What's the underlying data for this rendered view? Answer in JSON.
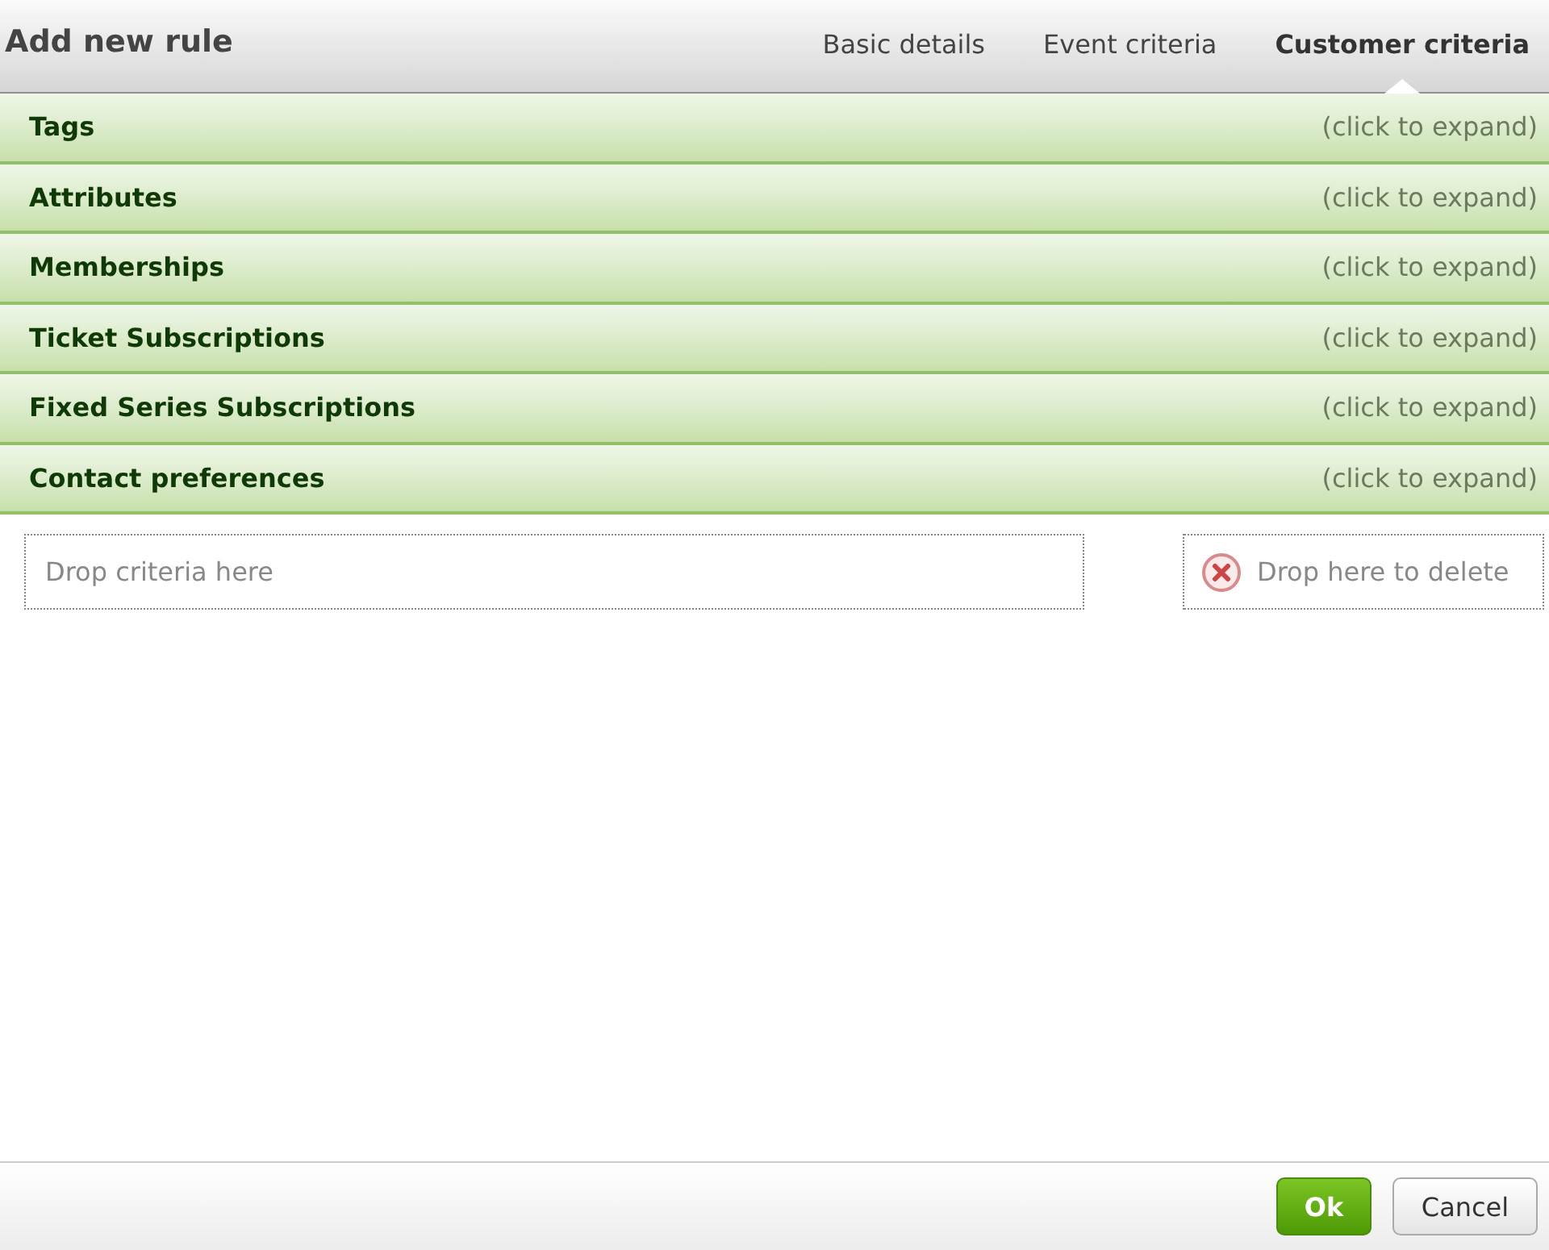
{
  "window": {
    "title": "Add new rule"
  },
  "tabs": [
    {
      "label": "Basic details",
      "selected": false
    },
    {
      "label": "Event criteria",
      "selected": false
    },
    {
      "label": "Customer criteria",
      "selected": true
    }
  ],
  "sections": [
    {
      "title": "Tags",
      "hint": "(click to expand)",
      "expanded": false
    },
    {
      "title": "Attributes",
      "hint": "(click to expand)",
      "expanded": false
    },
    {
      "title": "Memberships",
      "hint": "(click to expand)",
      "expanded": false
    },
    {
      "title": "Ticket Subscriptions",
      "hint": "(click to expand)",
      "expanded": false
    },
    {
      "title": "Fixed Series Subscriptions",
      "hint": "(click to expand)",
      "expanded": false
    },
    {
      "title": "Contact preferences",
      "hint": "(click to expand)",
      "expanded": false
    }
  ],
  "drop_zone": {
    "label": "Drop criteria here"
  },
  "delete_zone": {
    "label": "Drop here to delete"
  },
  "buttons": [
    {
      "label": "Ok",
      "kind": "primary"
    },
    {
      "label": "Cancel",
      "kind": "secondary"
    }
  ]
}
